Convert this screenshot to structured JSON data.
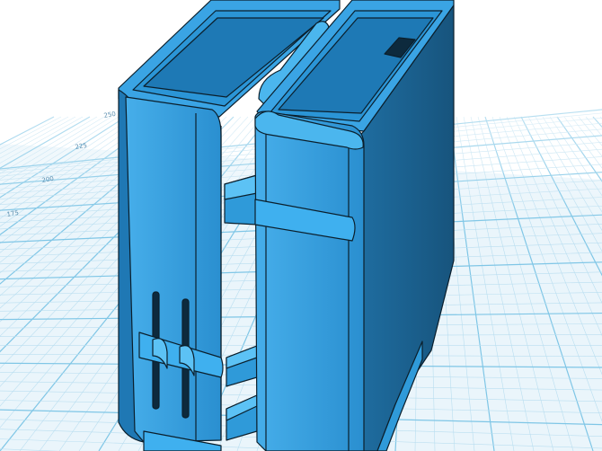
{
  "viewport": {
    "grid_color": "#7fc6e6",
    "grid_minor_color": "#b9def0",
    "model_color": "#2f9ad9",
    "model_shade": "#1b5f8c",
    "model_light": "#5cb9ef",
    "edge_color": "#0b1f2c"
  },
  "ruler": {
    "tick_labels": [
      "250",
      "225",
      "200",
      "175"
    ]
  },
  "model": {
    "parts": [
      "left-block",
      "right-block",
      "hinge-bar",
      "connector-brackets",
      "side-slots"
    ]
  }
}
